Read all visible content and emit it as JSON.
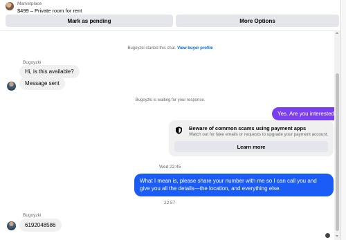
{
  "header": {
    "market_label": "Marketplace",
    "listing_title": "$499 – Private room for rent",
    "pending_button": "Mark as pending",
    "more_button": "More Options"
  },
  "chat": {
    "started_text": "Bugoyzki started this chat.",
    "view_profile_link": "View buyer profile",
    "sender_name": "Bugoyzki",
    "msg1": "Hi, is this available?",
    "msg2": "Message sent",
    "waiting_text": "Bugoyzki is waiting for your response.",
    "reply1": "Yes. Are you interested?",
    "scam_title": "Beware of common scams using payment apps",
    "scam_subtitle": "Watch out for fake emails or requests to upgrade your payment account.",
    "learn_more": "Learn more",
    "time1": "Wed 22:45",
    "reply2": "What I mean is, please share your number with me so I can call you and give you all the details—the location, and everything else.",
    "time2": "22:57",
    "sender_name_2": "Bugoyzki",
    "msg3": "6192048586"
  },
  "colors": {
    "accent_purple": "#7b3ff2",
    "accent_blue": "#1c5cf6",
    "link_blue": "#0064d1"
  },
  "icons": [
    "listing-thumbnail",
    "avatar",
    "shield-icon",
    "scroll-up-arrow",
    "scroll-down-arrow",
    "seen-avatar"
  ]
}
